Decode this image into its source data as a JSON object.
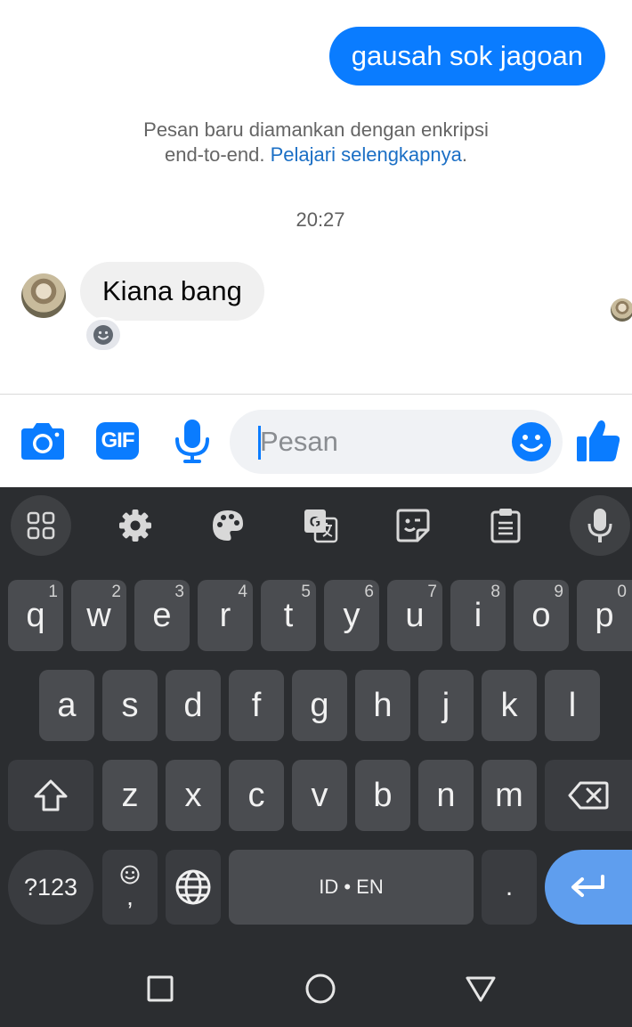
{
  "chat": {
    "outgoing_message": "gausah sok jagoan",
    "e2e_notice_line1": "Pesan baru diamankan dengan enkripsi",
    "e2e_notice_line2": "end-to-end.",
    "e2e_link": "Pelajari selengkapnya",
    "e2e_period": ".",
    "timestamp": "20:27",
    "incoming_message": "Kiana bang"
  },
  "composer": {
    "placeholder": "Pesan",
    "icons": [
      "camera-icon",
      "gif-icon",
      "microphone-icon",
      "emoji-icon",
      "thumbs-up-icon"
    ],
    "gif_label": "GIF",
    "accent_color": "#0a7cff"
  },
  "keyboard": {
    "toolbar": [
      "apps-grid-icon",
      "settings-gear-icon",
      "palette-icon",
      "translate-icon",
      "sticker-icon",
      "clipboard-icon",
      "microphone-icon"
    ],
    "row1": [
      {
        "key": "q",
        "hint": "1"
      },
      {
        "key": "w",
        "hint": "2"
      },
      {
        "key": "e",
        "hint": "3"
      },
      {
        "key": "r",
        "hint": "4"
      },
      {
        "key": "t",
        "hint": "5"
      },
      {
        "key": "y",
        "hint": "6"
      },
      {
        "key": "u",
        "hint": "7"
      },
      {
        "key": "i",
        "hint": "8"
      },
      {
        "key": "o",
        "hint": "9"
      },
      {
        "key": "p",
        "hint": "0"
      }
    ],
    "row2": [
      "a",
      "s",
      "d",
      "f",
      "g",
      "h",
      "j",
      "k",
      "l"
    ],
    "row3": [
      "z",
      "x",
      "c",
      "v",
      "b",
      "n",
      "m"
    ],
    "symbols_key": "?123",
    "comma_key": ",",
    "space_label": "ID • EN",
    "period_key": ".",
    "enter_color": "#5f9eee"
  },
  "navbar": {
    "buttons": [
      "recents-square-icon",
      "home-circle-icon",
      "back-triangle-icon"
    ]
  }
}
